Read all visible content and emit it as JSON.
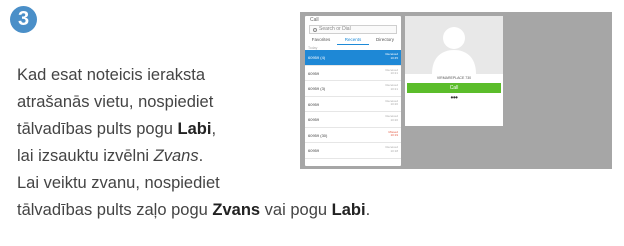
{
  "step": {
    "number": "3"
  },
  "instructions": {
    "l1": "Kad esat noteicis ieraksta",
    "l2": "atrašanās vietu, nospiediet",
    "l3_a": "tālvadības pults pogu ",
    "l3_b": "Labi",
    "l3_c": ",",
    "l4_a": "lai izsauktu izvēlni ",
    "l4_b": "Zvans",
    "l4_c": ".",
    "l5": "Lai veiktu zvanu, nospiediet",
    "l6_a": "tālvadības pults zaļo pogu ",
    "l6_b": "Zvans",
    "l6_c": " vai pogu ",
    "l6_d": "Labi",
    "l6_e": "."
  },
  "screen": {
    "call_panel": {
      "title": "Call",
      "search_placeholder": "Search or Dial",
      "tabs": [
        {
          "label": "Favorites"
        },
        {
          "label": "Recents"
        },
        {
          "label": "Directory"
        }
      ],
      "today_label": "Today",
      "rows": [
        {
          "name": "60959 (4)",
          "meta1": "Received",
          "meta2": "10:45"
        },
        {
          "name": "60959",
          "meta1": "Received",
          "meta2": "10:21"
        },
        {
          "name": "60959 (3)",
          "meta1": "Received",
          "meta2": "10:21"
        },
        {
          "name": "60959",
          "meta1": "Received",
          "meta2": "10:20"
        },
        {
          "name": "60959",
          "meta1": "Received",
          "meta2": "10:20"
        },
        {
          "name": "60959 (30)",
          "meta1": "Missed",
          "meta2": "10:19"
        },
        {
          "name": "60959",
          "meta1": "Received",
          "meta2": "10:18"
        }
      ]
    },
    "detail_panel": {
      "contact_name": "VIRMAREPLACE 730",
      "call_button": "Call",
      "more": "•••"
    }
  }
}
